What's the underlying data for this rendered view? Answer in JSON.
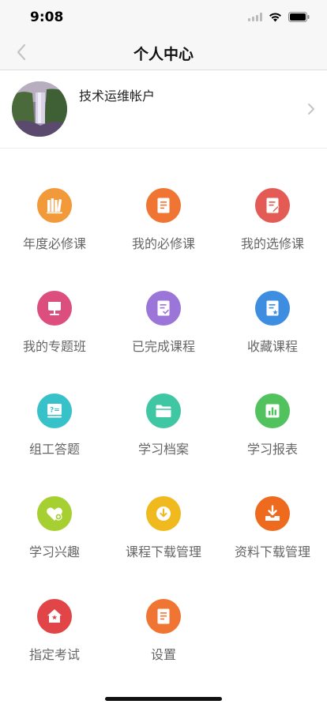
{
  "status_bar": {
    "time": "9:08"
  },
  "nav": {
    "title": "个人中心"
  },
  "profile": {
    "name": "技术运维帐户"
  },
  "grid": {
    "items": [
      {
        "label": "年度必修课",
        "color": "#F2993A",
        "icon": "books-icon"
      },
      {
        "label": "我的必修课",
        "color": "#F07533",
        "icon": "document-icon"
      },
      {
        "label": "我的选修课",
        "color": "#E45A55",
        "icon": "edit-document-icon"
      },
      {
        "label": "我的专题班",
        "color": "#DB4E7E",
        "icon": "podium-icon"
      },
      {
        "label": "已完成课程",
        "color": "#9C75D8",
        "icon": "checked-document-icon"
      },
      {
        "label": "收藏课程",
        "color": "#3D8EE0",
        "icon": "starred-document-icon"
      },
      {
        "label": "组工答题",
        "color": "#37C1C8",
        "icon": "question-board-icon"
      },
      {
        "label": "学习档案",
        "color": "#3FC6A2",
        "icon": "folder-icon"
      },
      {
        "label": "学习报表",
        "color": "#52C25E",
        "icon": "bar-chart-icon"
      },
      {
        "label": "学习兴趣",
        "color": "#A6CF31",
        "icon": "heart-plus-icon"
      },
      {
        "label": "课程下载管理",
        "color": "#F0BA1E",
        "icon": "download-circle-icon"
      },
      {
        "label": "资料下载管理",
        "color": "#EE6A1E",
        "icon": "download-tray-icon"
      },
      {
        "label": "指定考试",
        "color": "#E24548",
        "icon": "exam-house-icon"
      },
      {
        "label": "设置",
        "color": "#F07533",
        "icon": "settings-document-icon"
      }
    ]
  }
}
